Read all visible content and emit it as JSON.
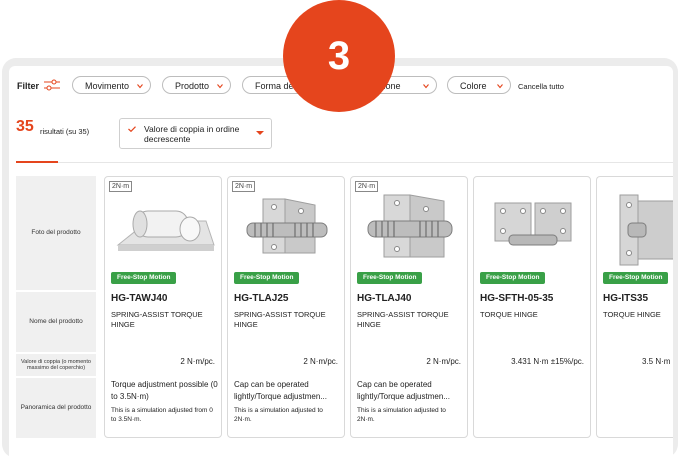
{
  "badge": "3",
  "filter": {
    "label": "Filter",
    "chips": [
      "Movimento",
      "Prodotto",
      "Forma del",
      "nzione",
      "Colore"
    ],
    "clear": "Cancella tutto"
  },
  "results": {
    "count": "35",
    "label": "risultati (su 35)",
    "sort": "Valore di coppia in ordine decrescente"
  },
  "rows": {
    "photo": "Foto del prodotto",
    "name": "Nome del prodotto",
    "torque": "Valore di coppia (o momento massimo del coperchio)",
    "overview": "Panoramica del prodotto"
  },
  "products": [
    {
      "unit": "2N·m",
      "tag": "Free-Stop Motion",
      "model": "HG-TAWJ40",
      "desc": "SPRING-ASSIST TORQUE HINGE",
      "torque": "2 N·m/pc.",
      "feature": "Torque adjustment possible (0 to 3.5N·m)",
      "note": "This is a simulation adjusted from 0 to 3.5N·m."
    },
    {
      "unit": "2N·m",
      "tag": "Free-Stop Motion",
      "model": "HG-TLAJ25",
      "desc": "SPRING-ASSIST TORQUE HINGE",
      "torque": "2 N·m/pc.",
      "feature": "Cap can be operated lightly/Torque adjustmen...",
      "note": "This is a simulation adjusted to 2N·m."
    },
    {
      "unit": "2N·m",
      "tag": "Free-Stop Motion",
      "model": "HG-TLAJ40",
      "desc": "SPRING-ASSIST TORQUE HINGE",
      "torque": "2 N·m/pc.",
      "feature": "Cap can be operated lightly/Torque adjustmen...",
      "note": "This is a simulation adjusted to 2N·m."
    },
    {
      "unit": "",
      "tag": "Free-Stop Motion",
      "model": "HG-SFTH-05-35",
      "desc": "TORQUE HINGE",
      "torque": "3.431 N·m ±15%/pc.",
      "feature": "",
      "note": ""
    },
    {
      "unit": "",
      "tag": "Free-Stop Motion",
      "model": "HG-ITS35",
      "desc": "TORQUE HINGE",
      "torque": "3.5 N·m",
      "feature": "",
      "note": ""
    }
  ],
  "colors": {
    "accent": "#e5451d",
    "tag": "#39a047"
  }
}
